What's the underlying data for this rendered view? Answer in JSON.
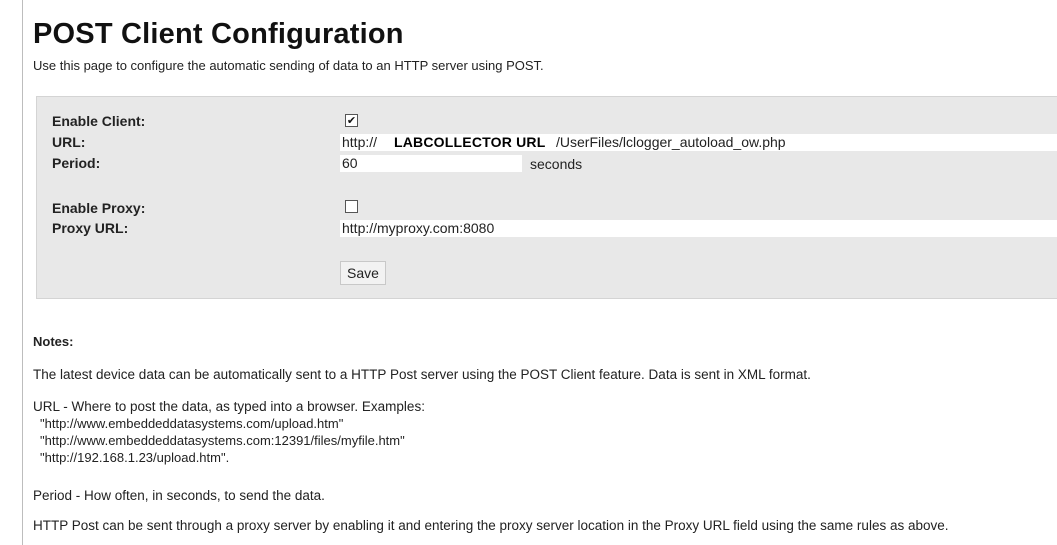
{
  "page": {
    "title": "POST Client Configuration",
    "subtitle": "Use this page to configure the automatic sending of data to an HTTP server using POST."
  },
  "form": {
    "enable_client": {
      "label": "Enable Client:",
      "checked": true,
      "mark": "✔"
    },
    "url": {
      "label": "URL:",
      "prefix": "http://",
      "overlay": "LABCOLLECTOR URL",
      "suffix": "/UserFiles/lclogger_autoload_ow.php"
    },
    "period": {
      "label": "Period:",
      "value": "60",
      "unit": "seconds"
    },
    "enable_proxy": {
      "label": "Enable Proxy:",
      "checked": false,
      "mark": ""
    },
    "proxy_url": {
      "label": "Proxy URL:",
      "value": "http://myproxy.com:8080"
    },
    "save_label": "Save"
  },
  "notes": {
    "title": "Notes:",
    "intro": "The latest device data can be automatically sent to a HTTP Post server using the POST Client feature. Data is sent in XML format.",
    "url_help": "URL - Where to post the data, as typed into a browser. Examples:",
    "examples": [
      "\"http://www.embeddeddatasystems.com/upload.htm\"",
      "\"http://www.embeddeddatasystems.com:12391/files/myfile.htm\"",
      "\"http://192.168.1.23/upload.htm\"."
    ],
    "period_help": "Period - How often, in seconds, to send the data.",
    "proxy_help": "HTTP Post can be sent through a proxy server by enabling it and entering the proxy server location in the Proxy URL field using the same rules as above."
  }
}
